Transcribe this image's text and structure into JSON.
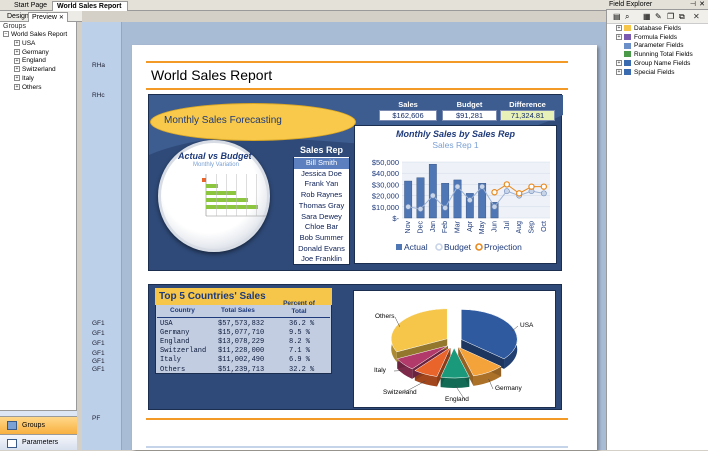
{
  "doc_tabs": {
    "start_page": "Start Page",
    "active": "World Sales Report",
    "close": "✕"
  },
  "view_tabs": {
    "design": "Design",
    "preview": "Preview",
    "close": "✕"
  },
  "groups": {
    "header": "Groups",
    "root": "World Sales Report",
    "children": [
      "USA",
      "Germany",
      "England",
      "Switzerland",
      "Italy",
      "Others"
    ]
  },
  "bottom_buttons": {
    "groups": "Groups",
    "parameters": "Parameters"
  },
  "sections": {
    "rha": "RHa",
    "rhc": "RHc",
    "gf1": "GF1",
    "pf": "PF"
  },
  "report": {
    "title": "World Sales Report",
    "forecast": "Monthly Sales Forecasting",
    "kpi": {
      "sales_label": "Sales",
      "sales_value": "$162,606",
      "budget_label": "Budget",
      "budget_value": "$91,281",
      "diff_label": "Difference",
      "diff_value": "71,324.81"
    },
    "avb": {
      "title": "Actual vs Budget",
      "subtitle": "Monthly Variation"
    },
    "sales_rep": {
      "header": "Sales Rep",
      "reps": [
        "Bill Smith",
        "Jessica Doe",
        "Frank Yan",
        "Rob Raynes",
        "Thomas Gray",
        "Sara Dewey",
        "Chloe Bar",
        "Bob Summer",
        "Donald Evans",
        "Joe Franklin"
      ],
      "selected": 0
    },
    "top5": {
      "title": "Top 5 Countries' Sales",
      "col_country": "Country",
      "col_sales": "Total Sales",
      "col_percent": "Percent of Total",
      "rows": [
        {
          "country": "USA",
          "sales": "$57,573,832",
          "pct": "36.2 %"
        },
        {
          "country": "Germany",
          "sales": "$15,077,710",
          "pct": "9.5 %"
        },
        {
          "country": "England",
          "sales": "$13,078,229",
          "pct": "8.2 %"
        },
        {
          "country": "Switzerland",
          "sales": "$11,228,000",
          "pct": "7.1 %"
        },
        {
          "country": "Italy",
          "sales": "$11,002,490",
          "pct": "6.9 %"
        },
        {
          "country": "Others",
          "sales": "$51,239,713",
          "pct": "32.2 %"
        }
      ]
    }
  },
  "field_explorer": {
    "title": "Field Explorer",
    "items": [
      "Database Fields",
      "Formula Fields",
      "Parameter Fields",
      "Running Total Fields",
      "Group Name Fields",
      "Special Fields"
    ]
  },
  "colors": {
    "accent_orange": "#f39a26",
    "panel_navy": "#2f4a78",
    "actual": "#4f77b5",
    "budget": "#c8d4e8",
    "projection": "#e8891e"
  },
  "chart_data": [
    {
      "type": "bar",
      "title": "Monthly Sales by Sales Rep",
      "subtitle": "Sales Rep 1",
      "categories": [
        "Nov",
        "Dec",
        "Jan",
        "Feb",
        "Mar",
        "Apr",
        "May",
        "Jun",
        "Jul",
        "Aug",
        "Sep",
        "Oct"
      ],
      "series": [
        {
          "name": "Actual",
          "values": [
            33000,
            36000,
            48000,
            31000,
            34000,
            22000,
            31000,
            14000,
            0,
            0,
            0,
            0
          ]
        },
        {
          "name": "Budget",
          "values": [
            10000,
            8000,
            20000,
            9000,
            28000,
            16000,
            28000,
            10000,
            24000,
            20000,
            24000,
            22000
          ]
        },
        {
          "name": "Projection",
          "values": [
            0,
            0,
            0,
            0,
            0,
            0,
            0,
            23000,
            30000,
            22000,
            28000,
            28000
          ]
        }
      ],
      "yticks": [
        "$-",
        "$10,000",
        "$20,000",
        "$30,000",
        "$40,000",
        "$50,000"
      ],
      "ylim": [
        0,
        50000
      ],
      "legend_position": "bottom"
    },
    {
      "type": "pie",
      "title": "",
      "categories": [
        "USA",
        "Germany",
        "England",
        "Switzerland",
        "Italy",
        "Others"
      ],
      "values": [
        36.2,
        9.5,
        8.2,
        7.1,
        6.9,
        32.2
      ],
      "colors": [
        "#2f5aa0",
        "#f4a23a",
        "#1a9a7a",
        "#e8642a",
        "#b23a6a",
        "#f5c64a"
      ]
    }
  ]
}
